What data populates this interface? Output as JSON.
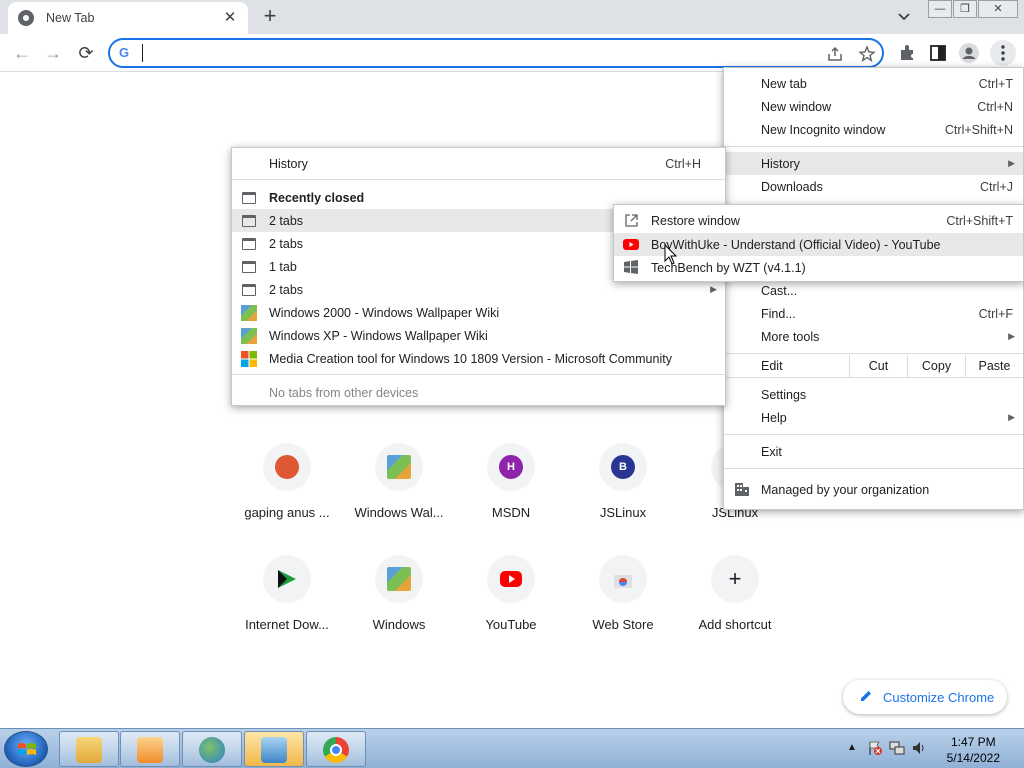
{
  "tab": {
    "title": "New Tab",
    "close": "✕",
    "new_tab": "+"
  },
  "window": {
    "minimize": "—",
    "restore": "❐",
    "close": "✕"
  },
  "toolbar": {
    "back": "←",
    "forward": "→",
    "reload": "⟳",
    "omnibox_value": "",
    "g_logo": "G"
  },
  "main_menu": {
    "items": [
      {
        "label": "New tab",
        "shortcut": "Ctrl+T"
      },
      {
        "label": "New window",
        "shortcut": "Ctrl+N"
      },
      {
        "label": "New Incognito window",
        "shortcut": "Ctrl+Shift+N"
      },
      {
        "label": "History",
        "shortcut": ""
      },
      {
        "label": "Downloads",
        "shortcut": "Ctrl+J"
      },
      {
        "label": "Cast...",
        "shortcut": ""
      },
      {
        "label": "Find...",
        "shortcut": "Ctrl+F"
      },
      {
        "label": "More tools",
        "shortcut": ""
      },
      {
        "label": "Settings",
        "shortcut": ""
      },
      {
        "label": "Help",
        "shortcut": ""
      },
      {
        "label": "Exit",
        "shortcut": ""
      }
    ],
    "edit": {
      "label": "Edit",
      "cut": "Cut",
      "copy": "Copy",
      "paste": "Paste"
    },
    "managed": "Managed by your organization"
  },
  "history_menu": {
    "history": {
      "label": "History",
      "shortcut": "Ctrl+H"
    },
    "recently_closed": "Recently closed",
    "entries": [
      {
        "label": "2 tabs"
      },
      {
        "label": "2 tabs"
      },
      {
        "label": "1 tab"
      },
      {
        "label": "2 tabs"
      },
      {
        "label": "Windows 2000 - Windows Wallpaper Wiki"
      },
      {
        "label": "Windows XP - Windows Wallpaper Wiki"
      },
      {
        "label": "Media Creation tool for Windows 10 1809 Version - Microsoft Community"
      }
    ],
    "no_tabs": "No tabs from other devices"
  },
  "tabs_submenu": {
    "restore": {
      "label": "Restore window",
      "shortcut": "Ctrl+Shift+T"
    },
    "items": [
      {
        "label": "BoyWithUke - Understand (Official Video) - YouTube"
      },
      {
        "label": "TechBench by WZT (v4.1.1)"
      }
    ]
  },
  "shortcuts": [
    {
      "label": "gaping anus ...",
      "letter": ""
    },
    {
      "label": "Windows Wal...",
      "letter": ""
    },
    {
      "label": "MSDN",
      "letter": "H"
    },
    {
      "label": "JSLinux",
      "letter": "B"
    },
    {
      "label": "JSLinux",
      "letter": ""
    },
    {
      "label": "Internet Dow...",
      "letter": ""
    },
    {
      "label": "Windows",
      "letter": ""
    },
    {
      "label": "YouTube",
      "letter": ""
    },
    {
      "label": "Web Store",
      "letter": ""
    },
    {
      "label": "Add shortcut",
      "letter": "+"
    }
  ],
  "customize": {
    "label": "Customize Chrome"
  },
  "taskbar": {
    "time": "1:47 PM",
    "date": "5/14/2022"
  },
  "colors": {
    "accent": "#1a73e8",
    "menu_highlight": "#e8e8e8",
    "youtube_red": "#ff0000",
    "msdn_purple": "#8e24aa",
    "jslinux_blue": "#283593"
  }
}
